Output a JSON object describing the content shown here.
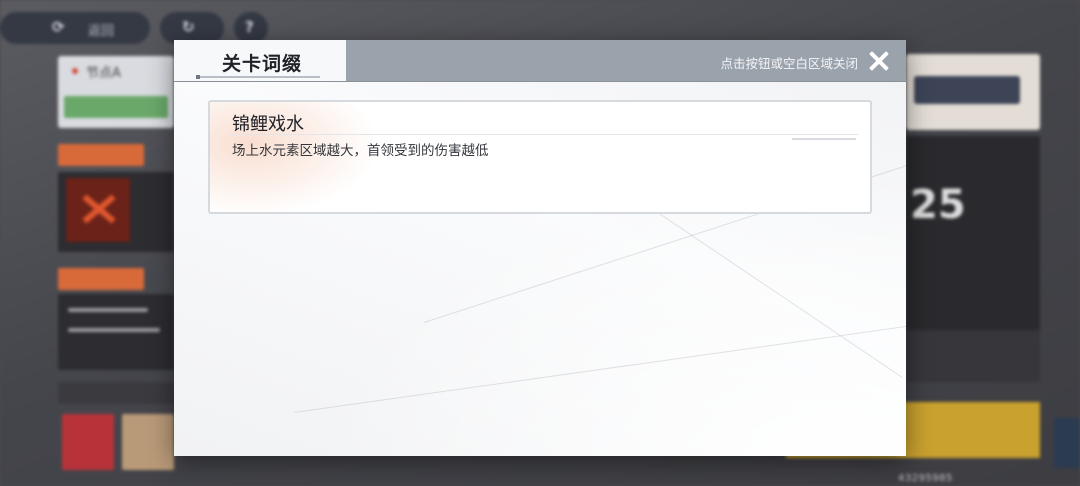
{
  "background": {
    "topbar": {
      "home_label": "返回"
    },
    "left_panel": {
      "node_label": "节点A"
    },
    "right_panel": {
      "level_number": "25"
    },
    "player_id": "43295985"
  },
  "modal": {
    "tab_title": "关卡词缀",
    "close_hint": "点击按钮或空白区域关闭",
    "affixes": [
      {
        "name": "锦鲤戏水",
        "description": "场上水元素区域越大，首领受到的伤害越低"
      }
    ]
  },
  "colors": {
    "header_bg": "#9aa2ac",
    "modal_bg": "#f7f8fa",
    "card_border": "#d6d9de",
    "title_text": "#1e2126"
  }
}
